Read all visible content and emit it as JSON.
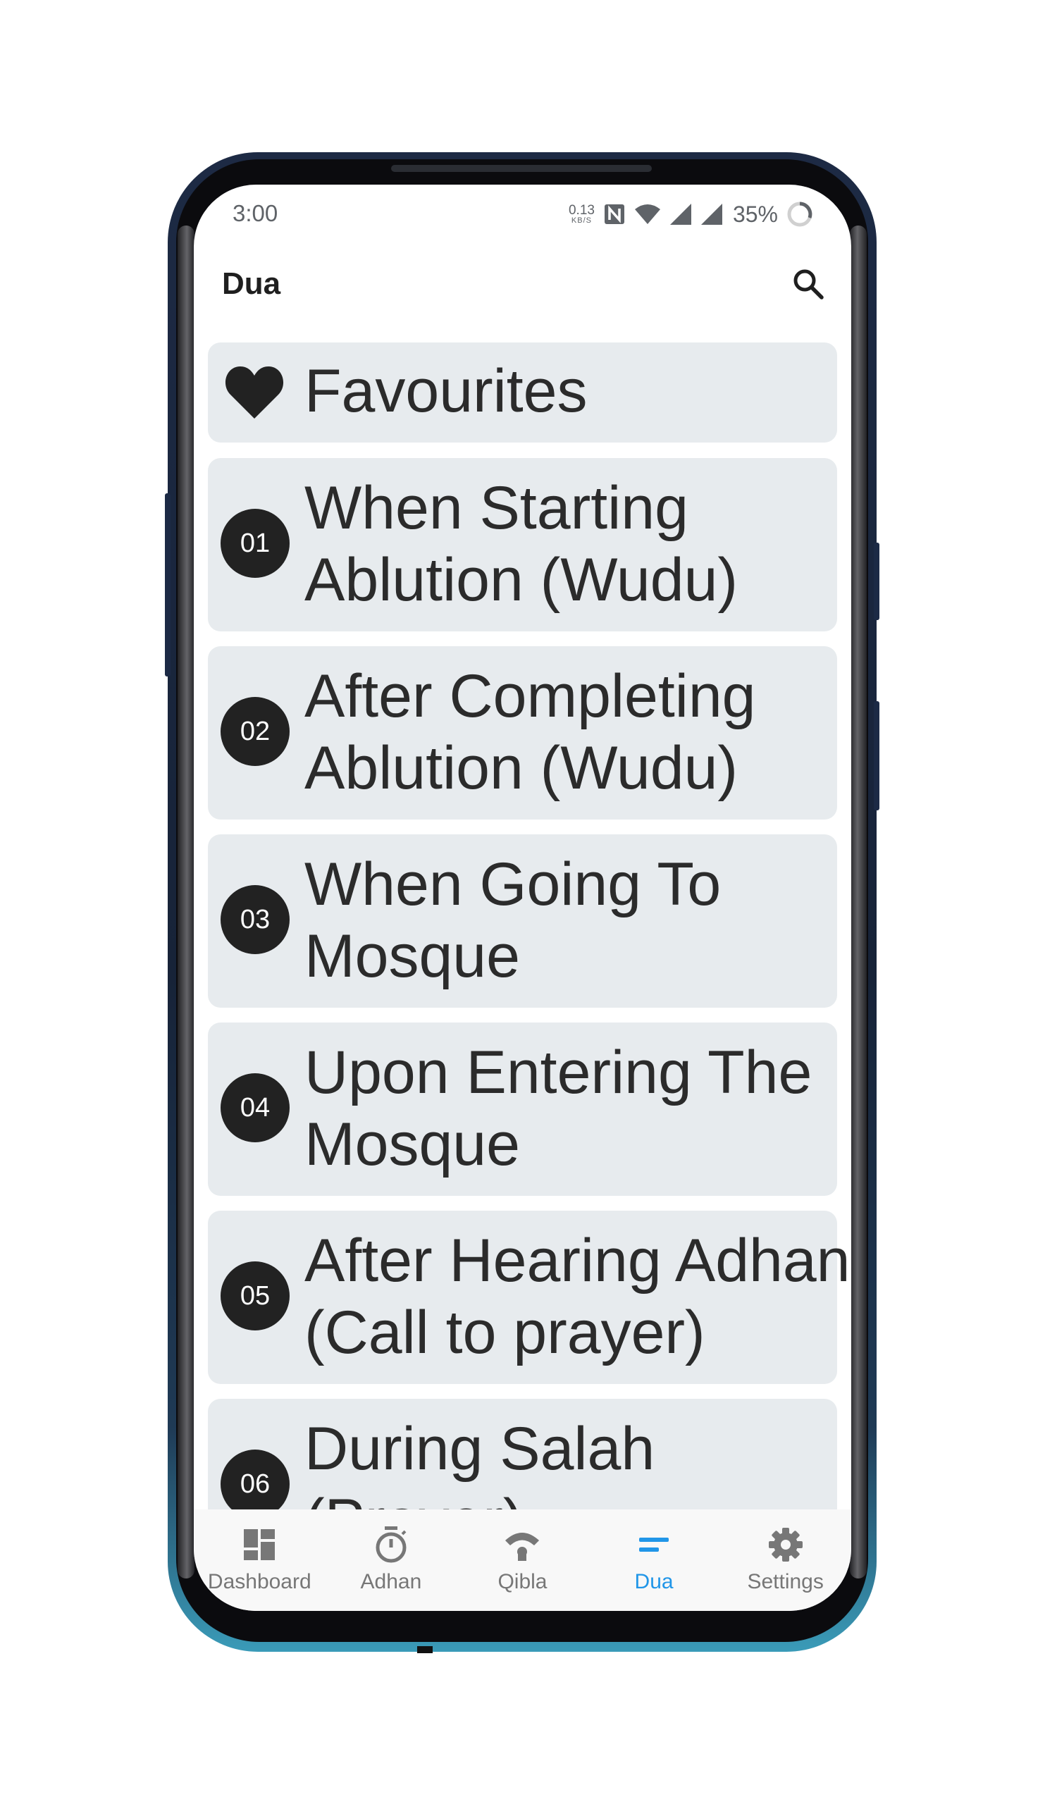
{
  "status_bar": {
    "time": "3:00",
    "net_speed_value": "0.13",
    "net_speed_unit": "KB/S",
    "battery_percent": "35%"
  },
  "app_bar": {
    "title": "Dua"
  },
  "favourites": {
    "label": "Favourites"
  },
  "duas": [
    {
      "number": "01",
      "title_line1": "When Starting",
      "title_line2": "Ablution (Wudu)"
    },
    {
      "number": "02",
      "title_line1": "After Completing",
      "title_line2": "Ablution (Wudu)"
    },
    {
      "number": "03",
      "title_line1": "When Going To",
      "title_line2": "Mosque"
    },
    {
      "number": "04",
      "title_line1": "Upon Entering The",
      "title_line2": "Mosque"
    },
    {
      "number": "05",
      "title_line1": "After Hearing Adhan",
      "title_line2": "(Call to prayer)"
    },
    {
      "number": "06",
      "title_line1": "During Salah",
      "title_line2": "(Prayer)"
    }
  ],
  "bottom_nav": {
    "active": "Dua",
    "items": [
      {
        "label": "Dashboard",
        "icon": "dashboard-icon"
      },
      {
        "label": "Adhan",
        "icon": "timer-icon"
      },
      {
        "label": "Qibla",
        "icon": "qibla-icon"
      },
      {
        "label": "Dua",
        "icon": "dua-icon"
      },
      {
        "label": "Settings",
        "icon": "gear-icon"
      }
    ]
  },
  "colors": {
    "accent": "#2196e8",
    "card_background": "#e7ebee",
    "badge_background": "#222222",
    "phone_frame": "#1d2a44"
  }
}
